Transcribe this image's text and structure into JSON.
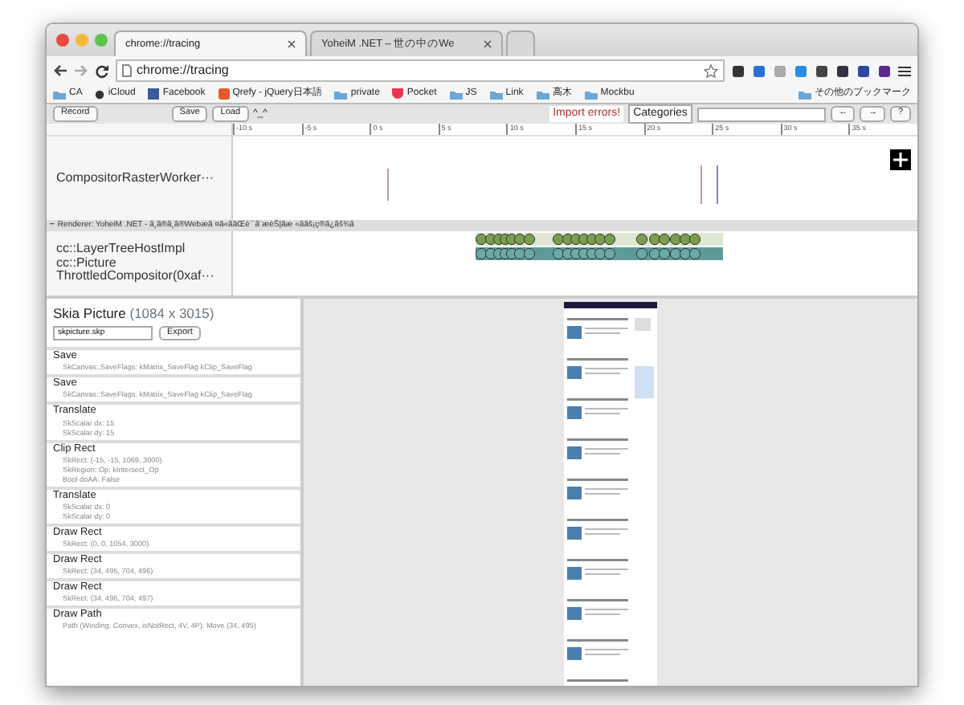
{
  "tabs": [
    {
      "title": "chrome://tracing",
      "selected": true
    },
    {
      "title": "YoheiM .NET – 世の中のWe",
      "selected": false
    }
  ],
  "address": "chrome://tracing",
  "bookmarks": [
    {
      "label": "CA",
      "kind": "folder"
    },
    {
      "label": "iCloud",
      "kind": "apple"
    },
    {
      "label": "Facebook",
      "kind": "facebook"
    },
    {
      "label": "Qrefy - jQuery日本語",
      "kind": "qrefy"
    },
    {
      "label": "private",
      "kind": "folder"
    },
    {
      "label": "Pocket",
      "kind": "pocket"
    },
    {
      "label": "JS",
      "kind": "folder"
    },
    {
      "label": "Link",
      "kind": "folder"
    },
    {
      "label": "高木",
      "kind": "folder"
    },
    {
      "label": "Mockbu",
      "kind": "folder"
    }
  ],
  "other_bookmarks": "その他のブックマーク",
  "tracing_toolbar": {
    "record": "Record",
    "save": "Save",
    "load": "Load",
    "face": "^_^",
    "import_errors": "Import errors!",
    "categories": "Categories",
    "prev": "←",
    "next": "→",
    "help": "?"
  },
  "ruler_ticks": [
    "-10 s",
    "-5 s",
    "0 s",
    "5 s",
    "10 s",
    "15 s",
    "20 s",
    "25 s",
    "30 s",
    "35 s"
  ],
  "tracks": [
    "CompositorRasterWorker···"
  ],
  "renderer": {
    "collapse": "−",
    "title": "Renderer: YoheiM .NET - ã¸ã®ã¸ã®Webæã ¤ã«ããŒé¨´ã¨æèŠ|ãæ «ããš¡ç®ã¿ãš¾ã"
  },
  "renderer_tracks": [
    "cc::LayerTreeHostImpl",
    "cc::Picture",
    "ThrottledCompositor(0xaf···"
  ],
  "skia": {
    "title": "Skia Picture",
    "dims": "(1084 x 3015)",
    "filename": "skpicture.skp",
    "export": "Export",
    "commands": [
      {
        "name": "Save",
        "args": [
          "SkCanvas::SaveFlags: kMatrix_SaveFlag kClip_SaveFlag"
        ]
      },
      {
        "name": "Save",
        "args": [
          "SkCanvas::SaveFlags: kMatrix_SaveFlag kClip_SaveFlag"
        ]
      },
      {
        "name": "Translate",
        "args": [
          "SkScalar dx: 15",
          "SkScalar dy: 15"
        ]
      },
      {
        "name": "Clip Rect",
        "args": [
          "SkRect: (-15, -15, 1069, 3000)",
          "SkRegion::Op: kIntersect_Op",
          "Bool doAA: False"
        ]
      },
      {
        "name": "Translate",
        "args": [
          "SkScalar dx: 0",
          "SkScalar dy: 0"
        ]
      },
      {
        "name": "Draw Rect",
        "args": [
          "SkRect: (0, 0, 1054, 3000)"
        ]
      },
      {
        "name": "Draw Rect",
        "args": [
          "SkRect: (34, 495, 704, 496)"
        ]
      },
      {
        "name": "Draw Rect",
        "args": [
          "SkRect: (34, 496, 704, 497)"
        ]
      },
      {
        "name": "Draw Path",
        "args": [
          "Path (Winding, Convex, isNotRect, 4V, 4P): Move (34, 495)"
        ]
      }
    ]
  }
}
